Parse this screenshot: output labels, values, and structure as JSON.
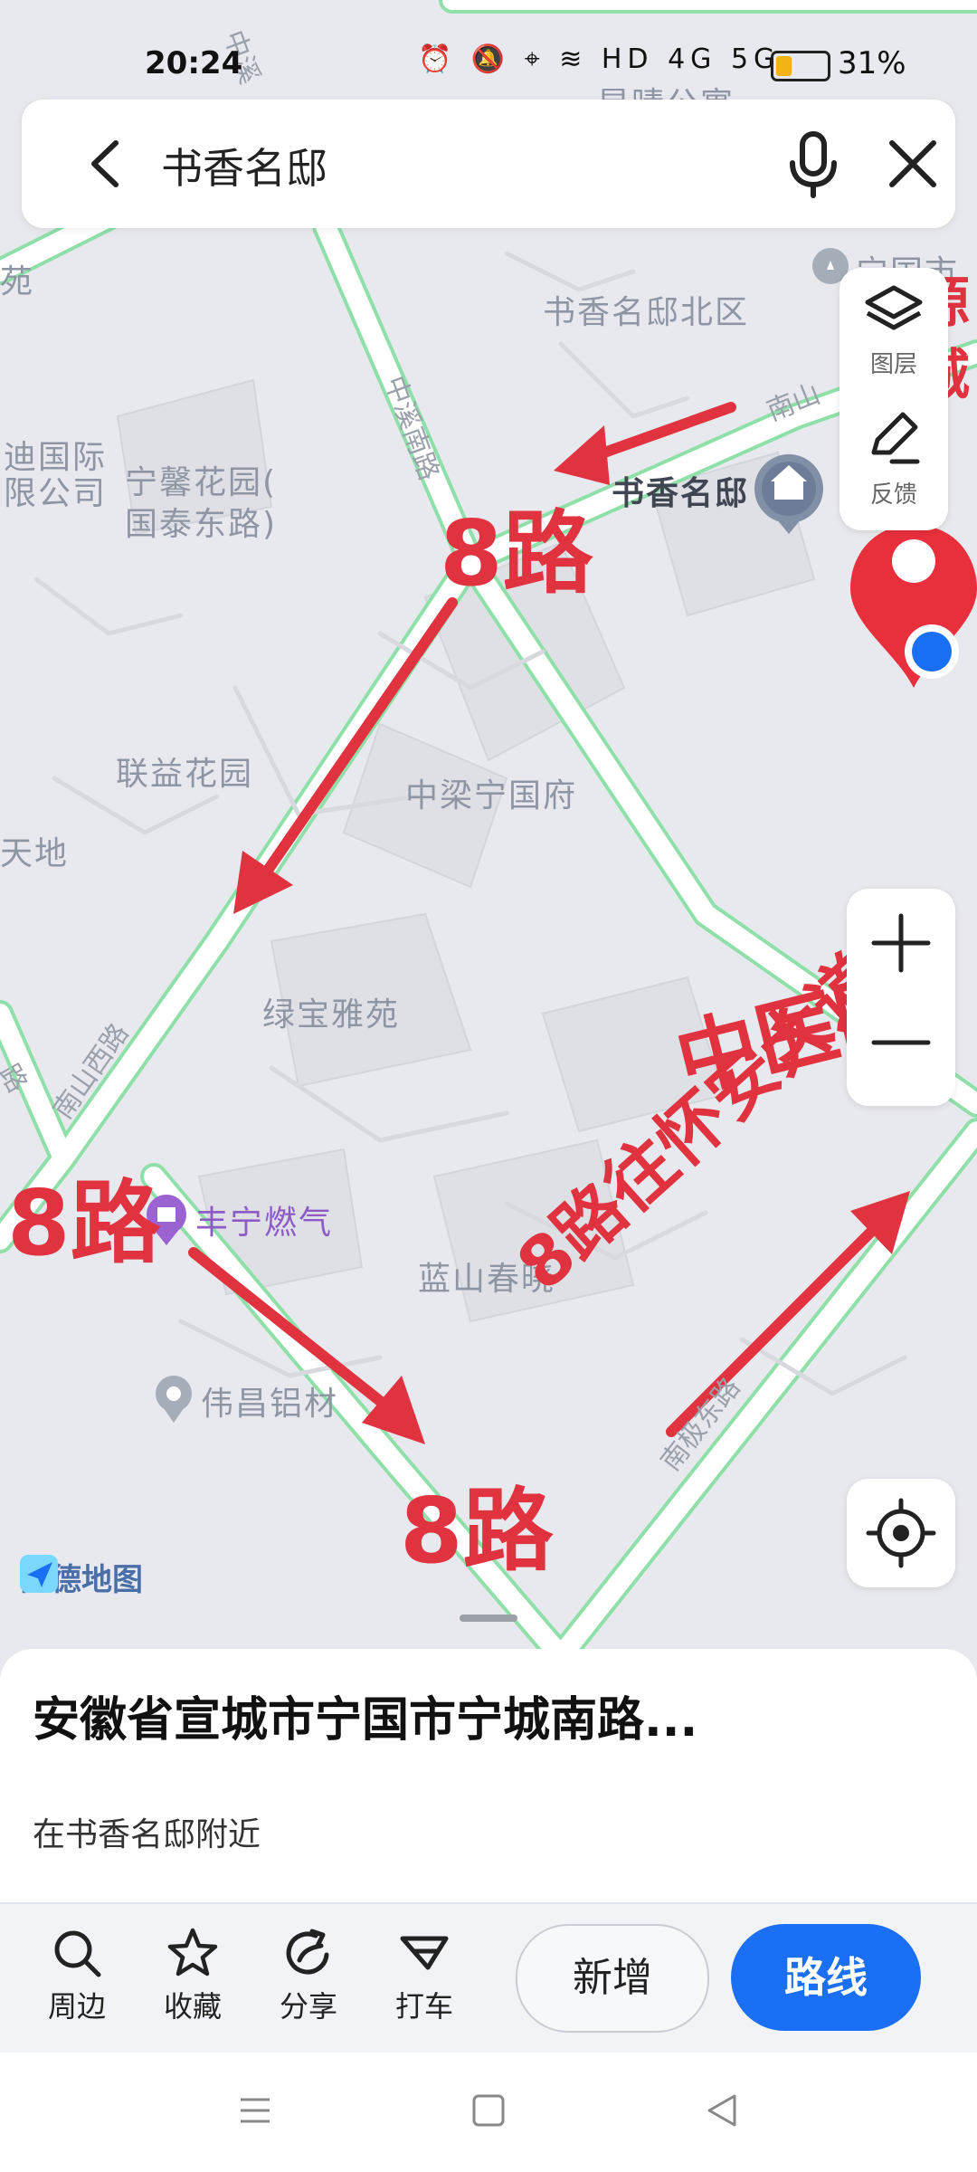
{
  "status_bar": {
    "time": "20:24",
    "icons_text": "⏰ 🔕 ⌖ ≋ HD 4G 5G",
    "battery_percent": "31%",
    "battery_level": 0.31
  },
  "search": {
    "query": "书香名邸"
  },
  "map": {
    "place_labels": {
      "shuxiang_north": "书香名邸北区",
      "shuxiang": "书香名邸",
      "yuxi_apartment": "昱晴公寓",
      "ningguo_partial": "宁国市",
      "ningxin": "宁馨花园(",
      "ningxin2": "国泰东路)",
      "di_guoji": "迪国际",
      "di_guoji2": "限公司",
      "lianyi": "联益花园",
      "zhongliang": "中梁宁国府",
      "tiandi": "天地",
      "lvbao": "绿宝雅苑",
      "fengning": "丰宁燃气",
      "lanshan": "蓝山春晓",
      "weichang": "伟昌铝材",
      "yuan": "苑"
    },
    "road_labels": {
      "zhongxi_top": "中溪",
      "zhongxi_south": "中溪南路",
      "nanshan": "南山",
      "nanshan_west": "南山西路",
      "nanji_east": "南极东路",
      "lu": "路"
    },
    "annotations": {
      "route_8_top": "8路",
      "route_8_left": "8路",
      "route_8_bottom": "8路",
      "route_to_huaian": "8路往怀安大道",
      "hospital": "中医院",
      "hengyuan_1": "恒源",
      "hengyuan_2": "景城"
    },
    "map_logo": "高德地图"
  },
  "side_buttons": {
    "layers_label": "图层",
    "feedback_label": "反馈"
  },
  "sheet": {
    "title": "安徽省宣城市宁国市宁城南路...",
    "subtitle": "在书香名邸附近"
  },
  "actions": {
    "nearby": "周边",
    "favorite": "收藏",
    "share": "分享",
    "taxi": "打车",
    "add": "新增",
    "route": "路线"
  },
  "colors": {
    "accent": "#1a6ff5",
    "annotation_red": "#e0323f",
    "road_green": "#8fe0a8",
    "map_bg": "#e8e9ee"
  }
}
